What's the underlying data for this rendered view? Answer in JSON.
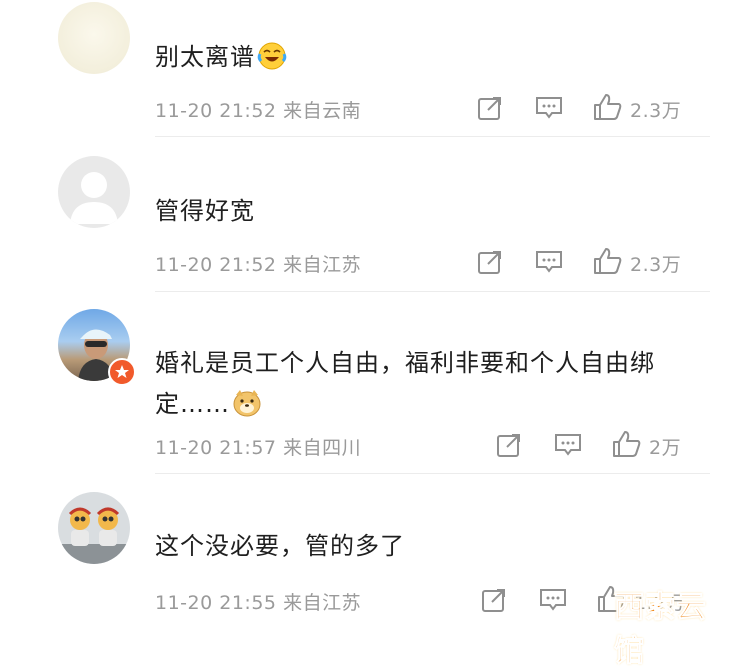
{
  "comments": [
    {
      "text": "别太离谱",
      "emoji": "laughing-crying-emoji",
      "time": "11-20 21:52",
      "location": "来自云南",
      "likes": "2.3万"
    },
    {
      "text": "管得好宽",
      "emoji": "",
      "time": "11-20 21:52",
      "location": "来自江苏",
      "likes": "2.3万"
    },
    {
      "text": "婚礼是员工个人自由，福利非要和个人自由绑定……",
      "emoji": "doge-emoji",
      "time": "11-20 21:57",
      "location": "来自四川",
      "likes": "2万"
    },
    {
      "text": "这个没必要，管的多了",
      "emoji": "",
      "time": "11-20 21:55",
      "location": "来自江苏",
      "likes": "1.5万"
    }
  ],
  "watermark": "西索云馆",
  "colors": {
    "text": "#1f1f1f",
    "meta": "#9a9a9a",
    "icon": "#8f8f8f",
    "badge": "#f15a2b",
    "watermark": "#f08a1c"
  }
}
